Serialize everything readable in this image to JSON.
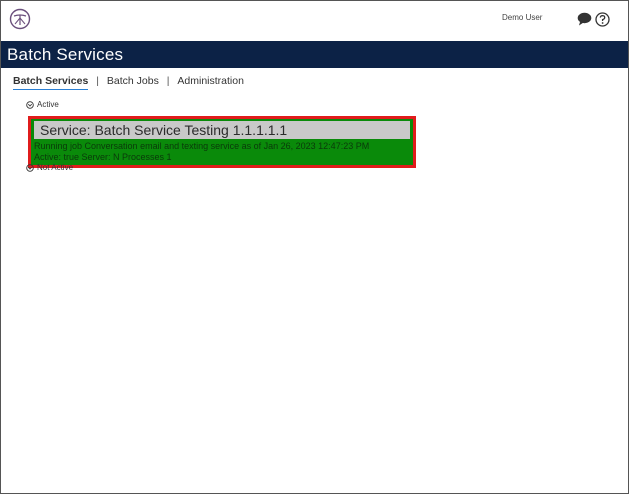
{
  "header": {
    "user_name": "Demo User",
    "logo_icon": "app-logo",
    "chat_icon": "chat-bubble-icon",
    "help_icon": "help-icon"
  },
  "titlebar": {
    "title": "Batch Services"
  },
  "tabs": [
    {
      "label": "Batch Services",
      "active": true
    },
    {
      "label": "Batch Jobs",
      "active": false
    },
    {
      "label": "Administration",
      "active": false
    }
  ],
  "tab_separator": "|",
  "groups": {
    "active_label": "Active",
    "inactive_label": "Not Active"
  },
  "service_card": {
    "title": "Service: Batch Service Testing 1.1.1.1.1",
    "status_line": "Running job Conversation email and texting service as of Jan 26, 2023 12:47:23 PM",
    "detail_line": "Active: true Server: N Processes 1"
  },
  "colors": {
    "titlebar_bg": "#0c2246",
    "card_status_bg": "#0a8a0a",
    "card_border": "#e01c1c",
    "card_head_bg": "#c9c9c9"
  }
}
